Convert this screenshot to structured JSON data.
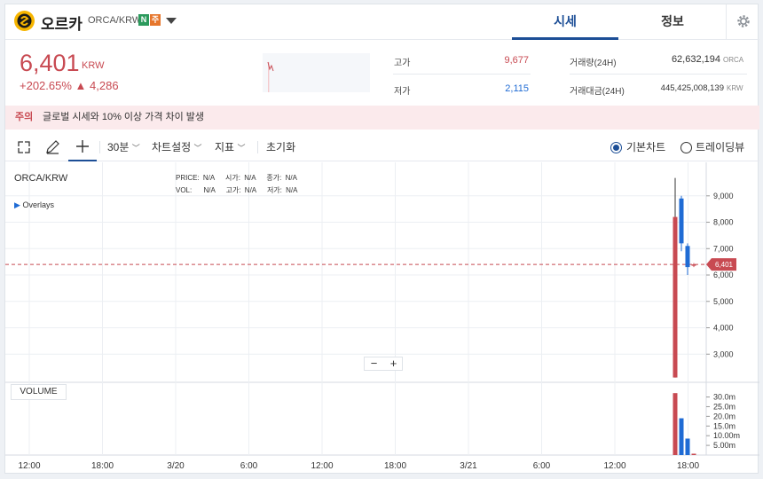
{
  "header": {
    "coin_name": "오르카",
    "pair": "ORCA/KRW",
    "badge_n": "N",
    "badge_w": "주",
    "tab_price": "시세",
    "tab_info": "정보"
  },
  "price": {
    "value": "6,401",
    "unit": "KRW",
    "change_rate": "+202.65%",
    "change_amount": "▲ 4,286"
  },
  "stats": {
    "high_label": "고가",
    "high_value": "9,677",
    "low_label": "저가",
    "low_value": "2,115",
    "vol_label": "거래량(24H)",
    "vol_value": "62,632,194",
    "vol_unit": "ORCA",
    "amount_label": "거래대금(24H)",
    "amount_value": "445,425,008,139",
    "amount_unit": "KRW"
  },
  "notice": {
    "label": "주의",
    "text": "글로벌 시세와 10% 이상 가격 차이 발생"
  },
  "toolbar": {
    "interval": "30분",
    "chart_settings": "차트설정",
    "indicators": "지표",
    "reset": "초기화",
    "basic_chart": "기본차트",
    "trading_view": "트레이딩뷰"
  },
  "chart_overlay": {
    "symbol": "ORCA/KRW",
    "overlays": "Overlays",
    "price_label": "PRICE:",
    "price_val": "N/A",
    "open_label": "시가:",
    "open_val": "N/A",
    "close_label": "종가:",
    "close_val": "N/A",
    "vol_label": "VOL:",
    "vol_val": "N/A",
    "high_label": "고가:",
    "high_val": "N/A",
    "low_label": "저가:",
    "low_val": "N/A",
    "volume_label": "VOLUME",
    "last_price": "6,401"
  },
  "colors": {
    "up": "#c84a52",
    "down": "#1f6bd4",
    "accent": "#1c4e96"
  },
  "chart_data": {
    "type": "candlestick",
    "x_ticks": [
      "12:00",
      "18:00",
      "3/20",
      "6:00",
      "12:00",
      "18:00",
      "3/21",
      "6:00",
      "12:00",
      "18:00"
    ],
    "y_ticks": [
      "9,000",
      "8,000",
      "7,000",
      "6,000",
      "5,000",
      "4,000",
      "3,000"
    ],
    "ylim": [
      2000,
      9800
    ],
    "volume_ticks": [
      "30.0m",
      "25.0m",
      "20.0m",
      "15.0m",
      "10.00m",
      "5.00m"
    ],
    "volume_ylim": [
      0,
      33000000
    ],
    "last_price": 6401,
    "candles": [
      {
        "open": 2115,
        "close": 8200,
        "high": 9677,
        "low": 2115,
        "volume": 32000000
      },
      {
        "open": 8900,
        "close": 7200,
        "high": 9000,
        "low": 6900,
        "volume": 19000000
      },
      {
        "open": 7100,
        "close": 6300,
        "high": 7200,
        "low": 6000,
        "volume": 8500000
      },
      {
        "open": 6350,
        "close": 6401,
        "high": 6450,
        "low": 6300,
        "volume": 700000
      }
    ]
  }
}
